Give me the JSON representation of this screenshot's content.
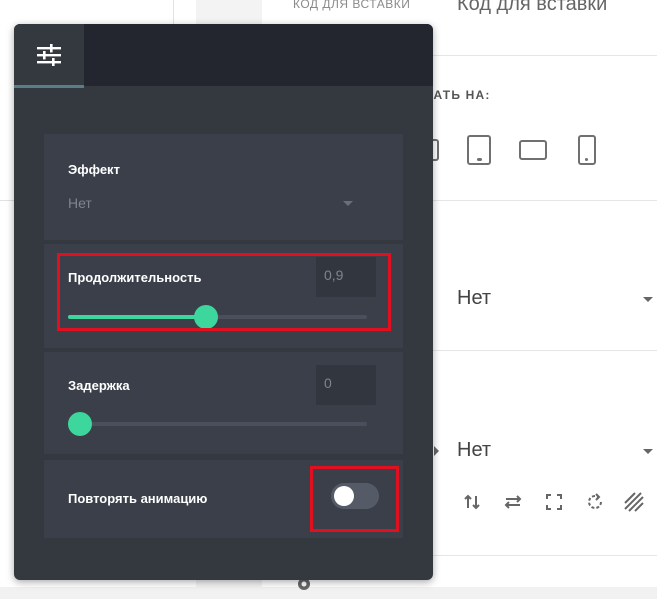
{
  "background": {
    "embed_small_label": "КОД ДЛЯ ВСТАВКИ",
    "embed_title": "Код для вставки",
    "show_on_label": "КАТЬ НА:",
    "devices": [
      "desktop-icon",
      "tablet-icon",
      "tablet-landscape-icon",
      "mobile-icon"
    ],
    "select_1_value": "Нет",
    "select_2_value": "Нет",
    "tools": [
      "flip-vertical-icon",
      "flip-horizontal-icon",
      "fit-icon",
      "rotate-icon",
      "pattern-icon"
    ]
  },
  "panel": {
    "tab_icon": "sliders-icon",
    "effect": {
      "label": "Эффект",
      "value": "Нет"
    },
    "duration": {
      "label": "Продолжительность",
      "value": "0,9",
      "slider_percent": 46
    },
    "delay": {
      "label": "Задержка",
      "value": "0",
      "slider_percent": 4
    },
    "repeat": {
      "label": "Повторять анимацию",
      "enabled": false
    }
  },
  "colors": {
    "accent": "#3dd69c",
    "panel_bg": "#34383f",
    "highlight": "#e01020"
  }
}
